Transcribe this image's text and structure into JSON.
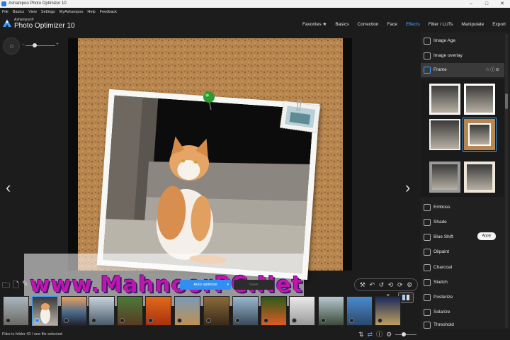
{
  "window": {
    "title": "Ashampoo Photo Optimizer 10",
    "controls": [
      "–",
      "□",
      "✕"
    ]
  },
  "menu": [
    "File",
    "Basics",
    "View",
    "Settings",
    "MyAshampoo",
    "Help",
    "Feedback"
  ],
  "logo": {
    "brand": "Ashampoo®",
    "product": "Photo Optimizer 10"
  },
  "tabs": [
    {
      "label": "Favorites ★",
      "active": false
    },
    {
      "label": "Basics",
      "active": false
    },
    {
      "label": "Correction",
      "active": false
    },
    {
      "label": "Face",
      "active": false
    },
    {
      "label": "Effects",
      "active": true
    },
    {
      "label": "Filter / LUTs",
      "active": false
    },
    {
      "label": "Manipulate",
      "active": false
    },
    {
      "label": "Export",
      "active": false
    }
  ],
  "viewer": {
    "prev_arrow": "‹",
    "next_arrow": "›",
    "watermark": "www.MahnoorPC.Net"
  },
  "actions": {
    "optimize_label": "Auto optimize",
    "optimize_caret": "▾",
    "save_label": "Save"
  },
  "panel": {
    "effects_top": [
      {
        "label": "Image Age",
        "icon": "image-age-icon"
      },
      {
        "label": "Image overlay",
        "icon": "image-overlay-icon"
      },
      {
        "label": "Frame",
        "icon": "frame-icon",
        "active": true,
        "extra": "☆ⓘ⊘"
      }
    ],
    "apply_label": "Apply",
    "effects_bottom": [
      {
        "label": "Emboss",
        "icon": "emboss-icon"
      },
      {
        "label": "Shade",
        "icon": "shade-icon"
      },
      {
        "label": "Blue Shift",
        "icon": "blue-shift-icon"
      },
      {
        "label": "Oilpaint",
        "icon": "oilpaint-icon"
      },
      {
        "label": "Charcoal",
        "icon": "charcoal-icon"
      },
      {
        "label": "Sketch",
        "icon": "sketch-icon"
      },
      {
        "label": "Posterize",
        "icon": "posterize-icon"
      },
      {
        "label": "Solarize",
        "icon": "solarize-icon"
      },
      {
        "label": "Threshold",
        "icon": "threshold-icon"
      }
    ]
  },
  "status": {
    "text": "Files in folder 43 / one file selected"
  },
  "colors": {
    "accent": "#2f8ff2",
    "active_tab": "#4aa8ff",
    "watermark": "#c016ad",
    "cork": "#b8864f"
  }
}
